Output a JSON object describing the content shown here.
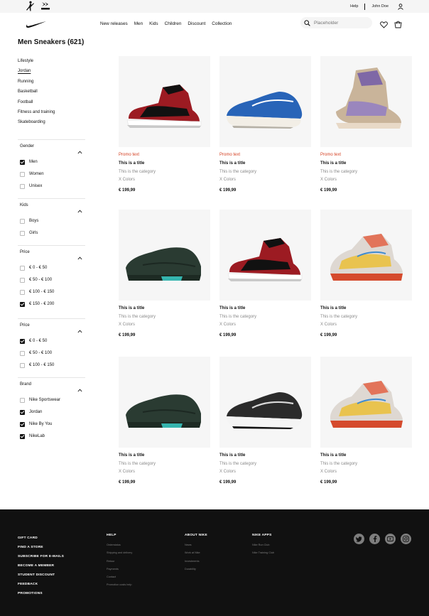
{
  "topbar": {
    "help": "Help",
    "user": "John Doe"
  },
  "nav": {
    "links": [
      "New releases",
      "Men",
      "Kids",
      "Children",
      "Discount",
      "Collection"
    ],
    "search_placeholder": "Placeholder"
  },
  "page_title": "Men Sneakers (621)",
  "categories": [
    "Lifestyle",
    "Jordan",
    "Running",
    "Basketball",
    "Football",
    "Fitness and training",
    "Skateboarding"
  ],
  "active_category": "Jordan",
  "filters": [
    {
      "title": "Gender",
      "options": [
        {
          "label": "Men",
          "checked": true
        },
        {
          "label": "Women",
          "checked": false
        },
        {
          "label": "Unisex",
          "checked": false
        }
      ]
    },
    {
      "title": "Kids",
      "options": [
        {
          "label": "Boys",
          "checked": false
        },
        {
          "label": "Girls",
          "checked": false
        }
      ]
    },
    {
      "title": "Price",
      "options": [
        {
          "label": "€ 0 - € 50",
          "checked": false
        },
        {
          "label": "€ 50 - € 100",
          "checked": false
        },
        {
          "label": "€ 100 - € 150",
          "checked": false
        },
        {
          "label": "€ 150 - € 200",
          "checked": true
        }
      ]
    },
    {
      "title": "Price",
      "options": [
        {
          "label": "€ 0 - € 50",
          "checked": true
        },
        {
          "label": "€ 50 - € 100",
          "checked": false
        },
        {
          "label": "€ 100 - € 150",
          "checked": false
        }
      ]
    },
    {
      "title": "Brand",
      "options": [
        {
          "label": "Nike Sportswear",
          "checked": false
        },
        {
          "label": "Jordan",
          "checked": true
        },
        {
          "label": "Nike By You",
          "checked": true
        },
        {
          "label": "NikeLab",
          "checked": true
        }
      ]
    }
  ],
  "products": [
    {
      "promo": "Promo text",
      "title": "This is a title",
      "category": "This is the category",
      "colors": "X Colors",
      "price": "€ 199,99",
      "shoe": "jordan-mid-red"
    },
    {
      "promo": "Promo text",
      "title": "This is a title",
      "category": "This is the category",
      "colors": "X Colors",
      "price": "€ 199,99",
      "shoe": "runner-blue"
    },
    {
      "promo": "Promo text",
      "title": "This is a title",
      "category": "This is the category",
      "colors": "X Colors",
      "price": "€ 199,99",
      "shoe": "jordan-high-tan"
    },
    {
      "promo": "",
      "title": "This is a title",
      "category": "This is the category",
      "colors": "X Colors",
      "price": "€ 199,99",
      "shoe": "trainer-green"
    },
    {
      "promo": "",
      "title": "This is a title",
      "category": "This is the category",
      "colors": "X Colors",
      "price": "€ 199,99",
      "shoe": "jordan-mid-red"
    },
    {
      "promo": "",
      "title": "This is a title",
      "category": "This is the category",
      "colors": "X Colors",
      "price": "€ 199,99",
      "shoe": "basketball-multi"
    },
    {
      "promo": "",
      "title": "This is a title",
      "category": "This is the category",
      "colors": "X Colors",
      "price": "€ 199,99",
      "shoe": "trainer-green"
    },
    {
      "promo": "",
      "title": "This is a title",
      "category": "This is the category",
      "colors": "X Colors",
      "price": "€ 199,99",
      "shoe": "runner-black"
    },
    {
      "promo": "",
      "title": "This is a title",
      "category": "This is the category",
      "colors": "X Colors",
      "price": "€ 199,99",
      "shoe": "basketball-multi"
    }
  ],
  "footer": {
    "main_links": [
      "GIFT CARD",
      "FIND A STORE",
      "SUBSCRIBE FOR E-MAILS",
      "BECOME A MEMBER",
      "STUDENT DISCOUNT",
      "FEEDBACK",
      "PROMOTIONS"
    ],
    "columns": [
      {
        "title": "HELP",
        "links": [
          "Orderstatus",
          "Shipping and delivery",
          "Retour",
          "Payments",
          "Contact",
          "Promotion costs help"
        ]
      },
      {
        "title": "ABOUT NIKE",
        "links": [
          "News",
          "Work at Nike",
          "Investments",
          "Durability"
        ]
      },
      {
        "title": "NIKE APPS",
        "links": [
          "Nike Run Club",
          "Nike Training Club"
        ]
      }
    ],
    "social": [
      "twitter-icon",
      "facebook-icon",
      "youtube-icon",
      "instagram-icon"
    ]
  },
  "colors": {
    "promo": "#d43f21",
    "footer_bg": "#111111",
    "muted": "#8a8a8a",
    "card_bg": "#f6f6f6"
  }
}
